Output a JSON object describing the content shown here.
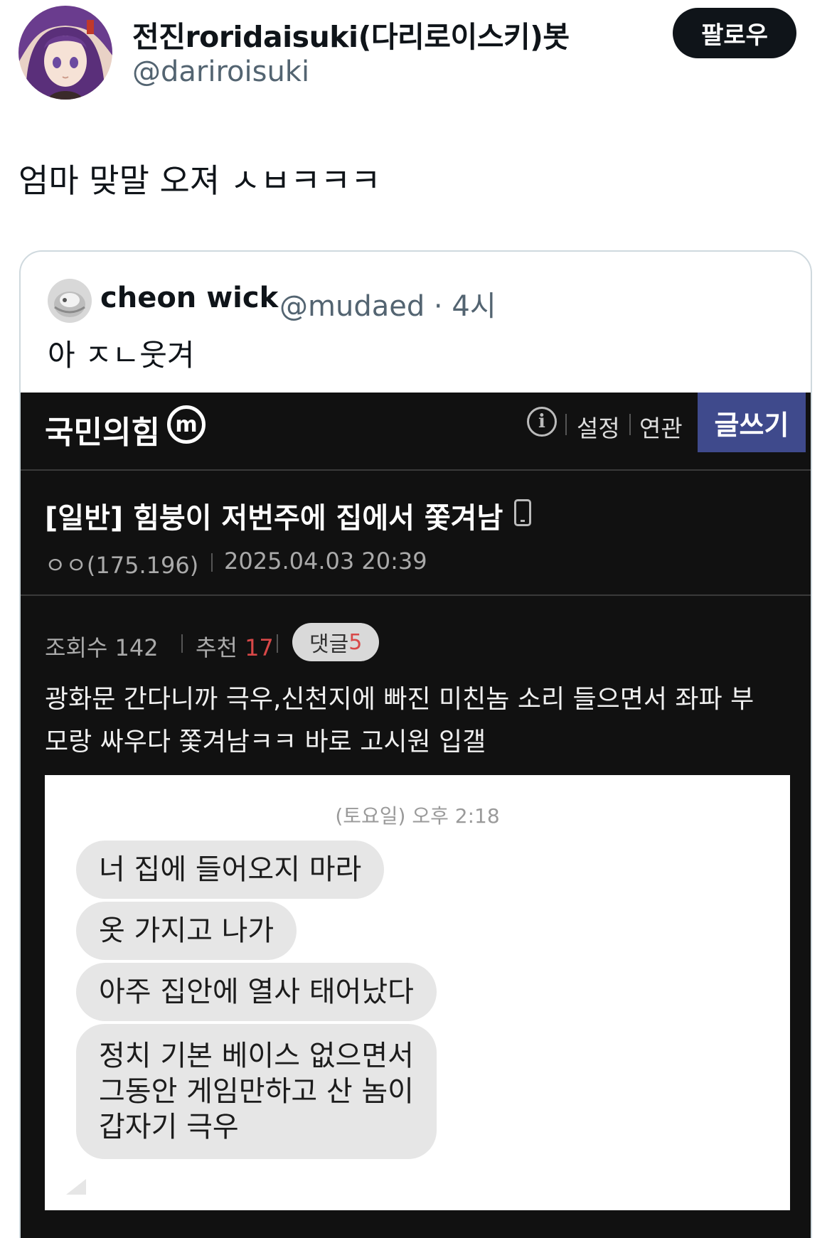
{
  "tweet": {
    "display_name": "전진roridaisuki(다리로이스키)봇",
    "handle": "@dariroisuki",
    "follow_label": "팔로우",
    "text": "엄마 맞말 오져 ㅅㅂㅋㅋㅋ"
  },
  "quote": {
    "name": "cheon wick",
    "meta": "@mudaed · 4시",
    "text": "아 ㅈㄴ웃겨"
  },
  "post_page": {
    "gallery_name": "국민의힘",
    "gallery_badge": "m",
    "info_icon_glyph": "i",
    "nav_settings": "설정",
    "nav_related": "연관",
    "write_label": "글쓰기",
    "title": "[일반] 힘붕이 저번주에 집에서 쫓겨남",
    "author": "ㅇㅇ(175.196)",
    "date": "2025.04.03 20:39",
    "views_label": "조회수",
    "views": "142",
    "recommend_label": "추천",
    "recommend": "17",
    "comments_label": "댓글",
    "comments": "5",
    "body_lines": [
      "광화문 간다니까 극우,신천지에 빠진 미친놈 소리 들으면서 좌파 부",
      "모랑 싸우다 쫓겨남ㅋㅋ 바로 고시원 입갤"
    ],
    "accent_color": "#3f4a8c",
    "background_color": "#111111"
  },
  "chat": {
    "timestamp": "(토요일) 오후 2:18",
    "messages": [
      "너 집에 들어오지 마라",
      "옷 가지고 나가",
      "아주 집안에 열사 태어났다"
    ],
    "last_message_lines": [
      "정치 기본 베이스 없으면서",
      "그동안 게임만하고 산 놈이",
      "갑자기 극우"
    ]
  }
}
